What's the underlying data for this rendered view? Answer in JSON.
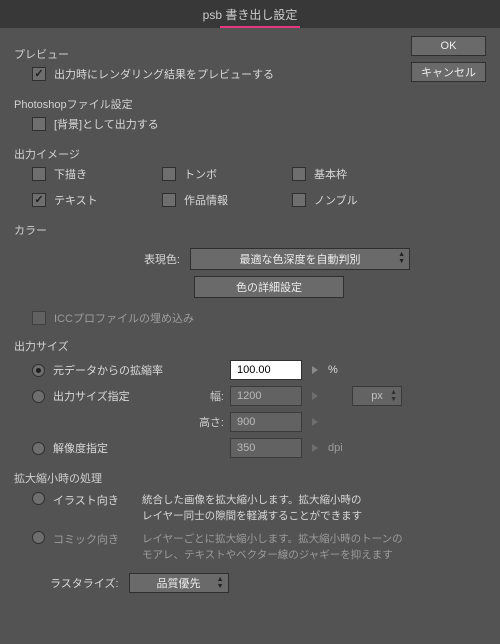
{
  "title": "psb 書き出し設定",
  "buttons": {
    "ok": "OK",
    "cancel": "キャンセル"
  },
  "preview": {
    "heading": "プレビュー",
    "cb_label": "出力時にレンダリング結果をプレビューする"
  },
  "psd": {
    "heading": "Photoshopファイル設定",
    "cb_label": "[背景]として出力する"
  },
  "image": {
    "heading": "出力イメージ",
    "items": {
      "draft": "下描き",
      "tombo": "トンボ",
      "kihon": "基本枠",
      "text": "テキスト",
      "sakuhin": "作品情報",
      "nombre": "ノンブル"
    }
  },
  "color": {
    "heading": "カラー",
    "expression_label": "表現色:",
    "expression_value": "最適な色深度を自動判別",
    "detail_btn": "色の詳細設定",
    "icc_label": "ICCプロファイルの埋め込み"
  },
  "size": {
    "heading": "出力サイズ",
    "r1": "元データからの拡縮率",
    "r2": "出力サイズ指定",
    "r3": "解像度指定",
    "width_lbl": "幅:",
    "height_lbl": "高さ:",
    "scale_val": "100.00",
    "scale_unit": "%",
    "width_val": "1200",
    "height_val": "900",
    "unit_val": "px",
    "res_val": "350",
    "res_unit": "dpi"
  },
  "scaling": {
    "heading": "拡大縮小時の処理",
    "r1": "イラスト向き",
    "r1_desc": "統合した画像を拡大縮小します。拡大縮小時の\nレイヤー同士の隙間を軽減することができます",
    "r2": "コミック向き",
    "r2_desc": "レイヤーごとに拡大縮小します。拡大縮小時のトーンの\nモアレ、テキストやベクター線のジャギーを抑えます",
    "raster_lbl": "ラスタライズ:",
    "raster_val": "品質優先"
  }
}
